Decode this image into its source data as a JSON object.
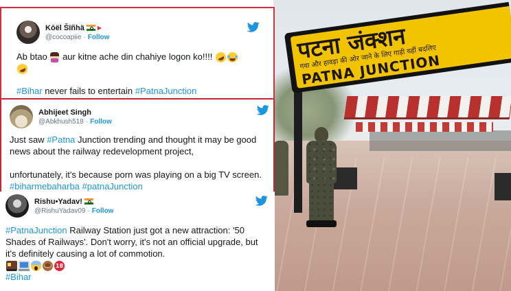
{
  "photo": {
    "sign_hindi": "पटना जंक्शन",
    "sign_hindi_sub": "गया और हावड़ा की ओर जाने के लिए गाड़ी यहीं बदलिए",
    "sign_english": "PATNA JUNCTION"
  },
  "tweets": [
    {
      "name": "Kōël Šïñhä",
      "handle": "@cocoapiie",
      "separator": "·",
      "follow": "Follow",
      "line1": "Ab btao",
      "line1b": "aur kitne ache din chahiye logon ko!!!!",
      "hashtag1": "#Bihar",
      "text_mid": "never fails to entertain",
      "hashtag2": "#PatnaJunction",
      "emojis": [
        "facepalm-emoji",
        "rofl-emoji",
        "joy-emoji",
        "rofl-emoji"
      ]
    },
    {
      "name": "Abhijeet Singh",
      "handle": "@Abkhush518",
      "separator": "·",
      "follow": "Follow",
      "text_a": "Just saw",
      "hashtag_a": "#Patna",
      "text_b": "Junction  trending and thought it may be good news about the railway redevelopment project,",
      "text_c": "unfortunately, it's because porn was playing on a big TV screen.",
      "hashtag_b": "#biharmebaharba",
      "hashtag_c": "#patnaJunction"
    },
    {
      "name": "Rishu•Yadav!",
      "handle": "@RishuYadav09",
      "separator": "·",
      "follow": "Follow",
      "hashtag_a": "#PatnaJunction",
      "text_a": "Railway Station just got a new attraction: '50 Shades of Railways'. Don't worry, it's not an official upgrade, but it's definitely causing a lot of commotion.",
      "hashtag_b": "#Bihar",
      "emojis": [
        "train-emoji",
        "laptop-emoji",
        "scream-emoji",
        "see-no-evil-emoji",
        "no-one-under-18-emoji"
      ]
    }
  ],
  "colors": {
    "twitter_blue": "#1b95e0",
    "frame_red": "#d5303a",
    "sign_yellow": "#f2c400"
  }
}
